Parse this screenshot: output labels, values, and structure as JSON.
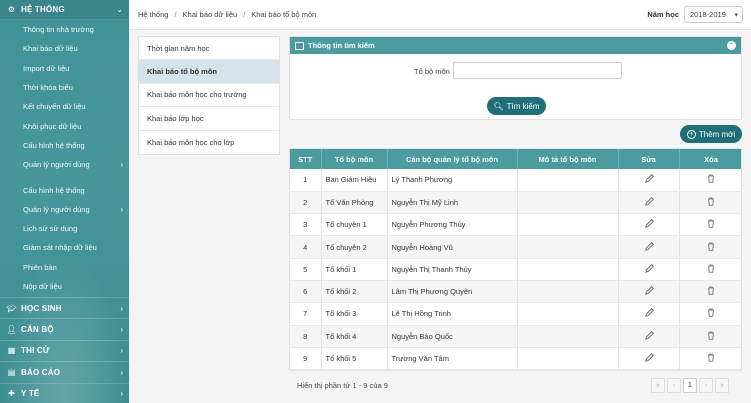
{
  "sidebar": {
    "section_main": "HỆ THỐNG",
    "items": [
      {
        "label": "Thông tin nhà trường",
        "sub": false
      },
      {
        "label": "Khai báo dữ liệu",
        "sub": false
      },
      {
        "label": "Import dữ liệu",
        "sub": false
      },
      {
        "label": "Thời khóa biểu",
        "sub": false
      },
      {
        "label": "Kết chuyển dữ liệu",
        "sub": false
      },
      {
        "label": "Khôi phục dữ liệu",
        "sub": false
      },
      {
        "label": "Cấu hình hệ thống",
        "sub": false
      },
      {
        "label": "Quản lý người dùng",
        "sub": true
      }
    ],
    "items2": [
      {
        "label": "Cấu hình hệ thống",
        "sub": false
      },
      {
        "label": "Quản lý người dùng",
        "sub": true
      },
      {
        "label": "Lịch sử sử dụng",
        "sub": false
      },
      {
        "label": "Giám sát nhập dữ liệu",
        "sub": false
      },
      {
        "label": "Phiên bản",
        "sub": false
      },
      {
        "label": "Nộp dữ liệu",
        "sub": false
      }
    ],
    "sections": [
      {
        "label": "HỌC SINH",
        "icon": "graduation-cap-icon"
      },
      {
        "label": "CÁN BỘ",
        "icon": "user-icon"
      },
      {
        "label": "THI CỬ",
        "icon": "calendar-icon"
      },
      {
        "label": "BÁO CÁO",
        "icon": "clipboard-icon"
      },
      {
        "label": "Y TẾ",
        "icon": "medical-icon"
      }
    ]
  },
  "breadcrumb": [
    "Hệ thống",
    "Khai báo dữ liệu",
    "Khai báo tổ bộ môn"
  ],
  "year": {
    "label": "Năm học",
    "value": "2018-2019"
  },
  "left_menu": [
    {
      "label": "Thời gian năm học",
      "active": false
    },
    {
      "label": "Khai báo tổ bộ môn",
      "active": true
    },
    {
      "label": "Khai báo môn học cho trường",
      "active": false
    },
    {
      "label": "Khai báo lớp học",
      "active": false
    },
    {
      "label": "Khai báo môn học cho lớp",
      "active": false
    }
  ],
  "search": {
    "title": "Thông tin tìm kiếm",
    "field_label": "Tổ bộ môn",
    "field_value": "",
    "button": "Tìm kiếm"
  },
  "add_button": "Thêm mới",
  "table": {
    "headers": [
      "STT",
      "Tổ bộ môn",
      "Cán bộ quản lý tổ bộ môn",
      "Mô tả tổ bộ môn",
      "Sửa",
      "Xóa"
    ],
    "rows": [
      [
        "1",
        "Ban Giám Hiệu",
        "Lý Thanh Phương",
        ""
      ],
      [
        "2",
        "Tổ Văn Phòng",
        "Nguyễn Thị Mỹ Linh",
        ""
      ],
      [
        "3",
        "Tổ chuyên 1",
        "Nguyễn Phương Thùy",
        ""
      ],
      [
        "4",
        "Tổ chuyên 2",
        "Nguyễn Hoàng Vũ",
        ""
      ],
      [
        "5",
        "Tổ khối 1",
        "Nguyễn Thị Thanh Thủy",
        ""
      ],
      [
        "6",
        "Tổ khối 2",
        "Lâm Thị Phương Quyên",
        ""
      ],
      [
        "7",
        "Tổ khối 3",
        "Lê Thị Hồng Trinh",
        ""
      ],
      [
        "8",
        "Tổ khối 4",
        "Nguyễn Bảo Quốc",
        ""
      ],
      [
        "9",
        "Tổ khối 5",
        "Trương Văn Tâm",
        ""
      ]
    ]
  },
  "footer": {
    "info": "Hiển thị phần tử 1 - 9 của 9",
    "pages": [
      "«",
      "‹",
      "1",
      "›",
      "»"
    ],
    "current_page": "1"
  }
}
